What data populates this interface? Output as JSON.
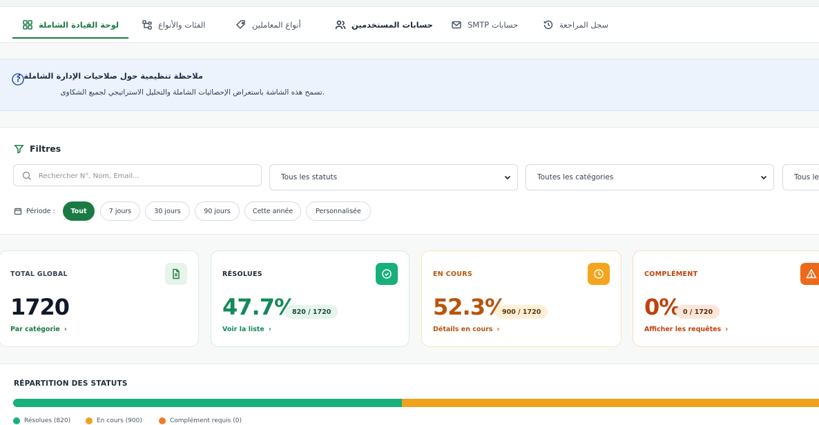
{
  "tabs": [
    {
      "label": "لوحة القيادة الشاملة",
      "icon": "grid-icon",
      "active": true
    },
    {
      "label": "الفئات والأنواع",
      "icon": "category-tree-icon"
    },
    {
      "label": "أنواع المعاملين",
      "icon": "tag-icon"
    },
    {
      "label": "حسابات المستخدمين",
      "icon": "users-icon"
    },
    {
      "label": "SMTP حسابات",
      "icon": "mail-icon"
    },
    {
      "label": "سجل المراجعة",
      "icon": "history-icon"
    }
  ],
  "notice": {
    "title": "ملاحظة تنظيمية حول صلاحيات الإدارة الشاملة :",
    "body": ".تسمح هذه الشاشة باستعراض الإحصائيات الشاملة والتحليل الاستراتيجي لجميع الشكاوى"
  },
  "filters": {
    "title": "Filtres",
    "search_placeholder": "Rechercher N°, Nom, Email...",
    "status_select": "Tous les statuts",
    "category_select": "Toutes les catégories",
    "extra_select": "Tous le",
    "period_label": "Période :",
    "periods": [
      "Tout",
      "7 jours",
      "30 jours",
      "90 jours",
      "Cette année",
      "Personnalisée"
    ],
    "active_period": "Tout"
  },
  "cards": [
    {
      "label": "TOTAL GLOBAL",
      "value": "1720",
      "badge": "",
      "link": "Par catégorie",
      "icon": "document-icon"
    },
    {
      "label": "RÉSOLUES",
      "value": "47.7%",
      "badge": "820 / 1720",
      "link": "Voir la liste",
      "icon": "check-circle-icon"
    },
    {
      "label": "EN COURS",
      "value": "52.3%",
      "badge": "900 / 1720",
      "link": "Détails en cours",
      "icon": "clock-icon"
    },
    {
      "label": "COMPLÉMENT",
      "value": "0%",
      "badge": "0 / 1720",
      "link": "Afficher les requêtes",
      "icon": "warning-icon"
    }
  ],
  "distribution": {
    "title": "RÉPARTITION DES STATUTS",
    "segments": [
      {
        "label": "Résolues (820)",
        "value": 820,
        "color": "#17b07a"
      },
      {
        "label": "En cours (900)",
        "value": 900,
        "color": "#f0a11d"
      },
      {
        "label": "Complément requis (0)",
        "value": 0,
        "color": "#f07a2a"
      }
    ],
    "total": 1720
  },
  "colors": {
    "primary": "#1b7a43",
    "green": "#17b07a",
    "orange": "#f0a11d",
    "red": "#e8590c"
  }
}
